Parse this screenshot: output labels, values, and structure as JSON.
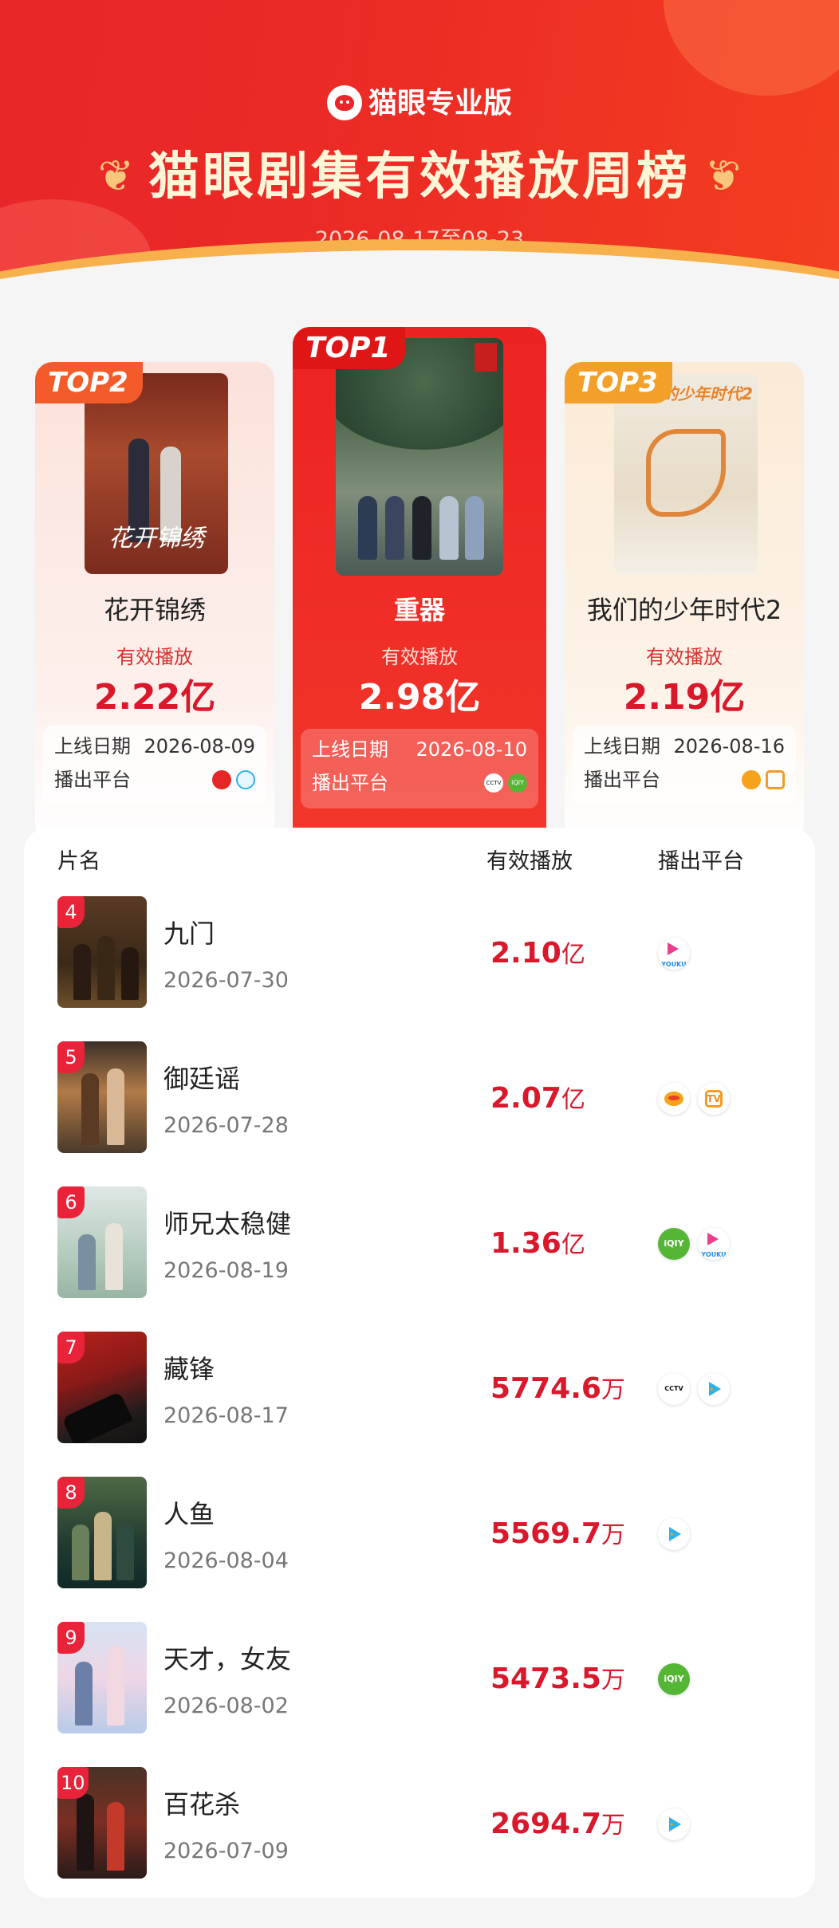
{
  "header": {
    "brand": "猫眼专业版",
    "title": "猫眼剧集有效播放周榜",
    "date_range": "2026-08-17至08-23",
    "colors": {
      "brand_red": "#e8262a",
      "accent_orange": "#f7b04c"
    }
  },
  "podium": [
    {
      "rank_label": "TOP1",
      "title": "重器",
      "metric_label": "有效播放",
      "value": "2.98亿",
      "release_label": "上线日期",
      "release_date": "2026-08-10",
      "platform_label": "播出平台",
      "platforms": [
        "cctv-icon",
        "iqiyi-icon"
      ]
    },
    {
      "rank_label": "TOP2",
      "title": "花开锦绣",
      "poster_caption": "花开锦绣",
      "metric_label": "有效播放",
      "value": "2.22亿",
      "release_label": "上线日期",
      "release_date": "2026-08-09",
      "platform_label": "播出平台",
      "platforms": [
        "cctv-red-icon",
        "tencent-video-icon"
      ]
    },
    {
      "rank_label": "TOP3",
      "title": "我们的少年时代2",
      "poster_caption": "我们的少年时代2",
      "metric_label": "有效播放",
      "value": "2.19亿",
      "release_label": "上线日期",
      "release_date": "2026-08-16",
      "platform_label": "播出平台",
      "platforms": [
        "mango-tv-icon",
        "mgtv-icon"
      ]
    }
  ],
  "list": {
    "headers": {
      "name": "片名",
      "plays": "有效播放",
      "platform": "播出平台"
    },
    "rows": [
      {
        "rank": "4",
        "title": "九门",
        "date": "2026-07-30",
        "value": "2.10",
        "unit": "亿",
        "platforms": [
          "youku-icon"
        ]
      },
      {
        "rank": "5",
        "title": "御廷谣",
        "date": "2026-07-28",
        "value": "2.07",
        "unit": "亿",
        "platforms": [
          "mango-tv-icon",
          "mgtv-icon"
        ]
      },
      {
        "rank": "6",
        "title": "师兄太稳健",
        "date": "2026-08-19",
        "value": "1.36",
        "unit": "亿",
        "platforms": [
          "iqiyi-icon",
          "youku-icon"
        ]
      },
      {
        "rank": "7",
        "title": "藏锋",
        "date": "2026-08-17",
        "value": "5774.6",
        "unit": "万",
        "platforms": [
          "cctv-icon",
          "tencent-video-icon"
        ]
      },
      {
        "rank": "8",
        "title": "人鱼",
        "date": "2026-08-04",
        "value": "5569.7",
        "unit": "万",
        "platforms": [
          "tencent-video-icon"
        ]
      },
      {
        "rank": "9",
        "title": "天才，女友",
        "date": "2026-08-02",
        "value": "5473.5",
        "unit": "万",
        "platforms": [
          "iqiyi-icon"
        ]
      },
      {
        "rank": "10",
        "title": "百花杀",
        "date": "2026-07-09",
        "value": "2694.7",
        "unit": "万",
        "platforms": [
          "tencent-video-icon"
        ]
      }
    ]
  },
  "icon_text": {
    "iqiyi": "iQIY",
    "youku": "YOUKU",
    "mgtv": "TV",
    "cctv": "CCTV"
  }
}
